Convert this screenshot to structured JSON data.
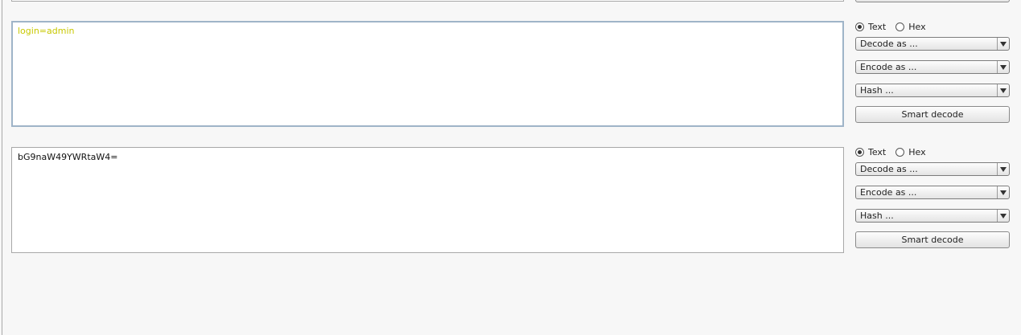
{
  "input_panel": {
    "text": "login=admin",
    "radio_text_label": "Text",
    "radio_hex_label": "Hex",
    "selected_mode": "Text",
    "decode_label": "Decode as ...",
    "encode_label": "Encode as ...",
    "hash_label": "Hash ...",
    "smart_decode_label": "Smart decode"
  },
  "output_panel": {
    "text": "bG9naW49YWRtaW4=",
    "radio_text_label": "Text",
    "radio_hex_label": "Hex",
    "selected_mode": "Text",
    "decode_label": "Decode as ...",
    "encode_label": "Encode as ...",
    "hash_label": "Hash ...",
    "smart_decode_label": "Smart decode"
  },
  "colors": {
    "input_text": "#c8c800",
    "focus_border": "#9fb4c8"
  }
}
